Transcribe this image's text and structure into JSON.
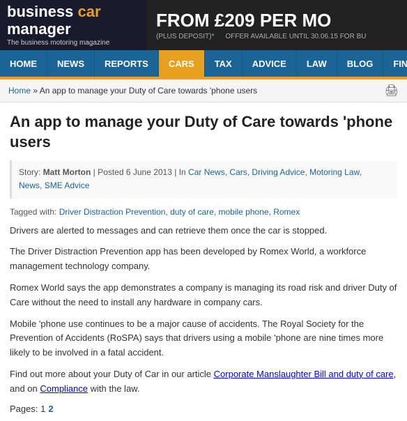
{
  "header": {
    "logo_line1_biz": "business ",
    "logo_line1_car": "car",
    "logo_line2": "manager",
    "logo_tagline": "The business motoring magazine",
    "banner_main": "FROM £209 PER MO",
    "banner_sub1": "(PLUS DEPOSIT)*",
    "banner_sub2": "OFFER AVAILABLE UNTIL 30.06.15 FOR BU"
  },
  "nav": {
    "items": [
      {
        "label": "HOME",
        "active": false
      },
      {
        "label": "NEWS",
        "active": false
      },
      {
        "label": "REPORTS",
        "active": false
      },
      {
        "label": "CARS",
        "active": true
      },
      {
        "label": "TAX",
        "active": false
      },
      {
        "label": "ADVICE",
        "active": false
      },
      {
        "label": "LAW",
        "active": false
      },
      {
        "label": "BLOG",
        "active": false
      },
      {
        "label": "FIND A SUPPLIER",
        "active": false
      }
    ],
    "more": "▶"
  },
  "breadcrumb": {
    "home": "Home",
    "separator": " » ",
    "current": "An app to manage your Duty of Care towards 'phone users"
  },
  "article": {
    "title": "An app to manage your Duty of Care towards 'phone users",
    "meta_story": "Story: ",
    "meta_author": "Matt Morton",
    "meta_sep1": " | ",
    "meta_posted": "Posted 6 June 2013",
    "meta_sep2": " | In ",
    "meta_cats": [
      {
        "label": "Car News",
        "href": "#"
      },
      {
        "label": "Cars",
        "href": "#"
      },
      {
        "label": "Driving Advice",
        "href": "#"
      },
      {
        "label": "Motoring Law",
        "href": "#"
      },
      {
        "label": "News",
        "href": "#"
      },
      {
        "label": "SME Advice",
        "href": "#"
      }
    ],
    "tags_prefix": "Tagged with: ",
    "tags": [
      {
        "label": "Driver Distraction Prevention",
        "href": "#"
      },
      {
        "label": "duty of care",
        "href": "#"
      },
      {
        "label": "mobile phone",
        "href": "#"
      },
      {
        "label": "Romex",
        "href": "#"
      }
    ],
    "paragraphs": [
      "Drivers are alerted to messages and can retrieve them once the car is stopped.",
      "The Driver Distraction Prevention app has been developed by Romex World, a workforce management technology company.",
      "Romex World says the app demonstrates a company is managing its road risk and driver Duty of Care without the need to install any hardware in company cars.",
      "Mobile 'phone use continues to be a major cause of accidents. The Royal Society for the Prevention of Accidents (RoSPA) says that drivers using a mobile 'phone are nine times more likely to be involved in a fatal accident.",
      "Find out more about your Duty of Car in our article [LINK1] and on [LINK2] with the law."
    ],
    "para5_text1": "Find out more about your Duty of Car in our article ",
    "para5_link1": "Corporate Manslaughter Bill and duty of care",
    "para5_text2": ", and on ",
    "para5_link2": "Compliance",
    "para5_text3": " with the law.",
    "pages_label": "Pages: 1",
    "pages_p2": "2"
  }
}
